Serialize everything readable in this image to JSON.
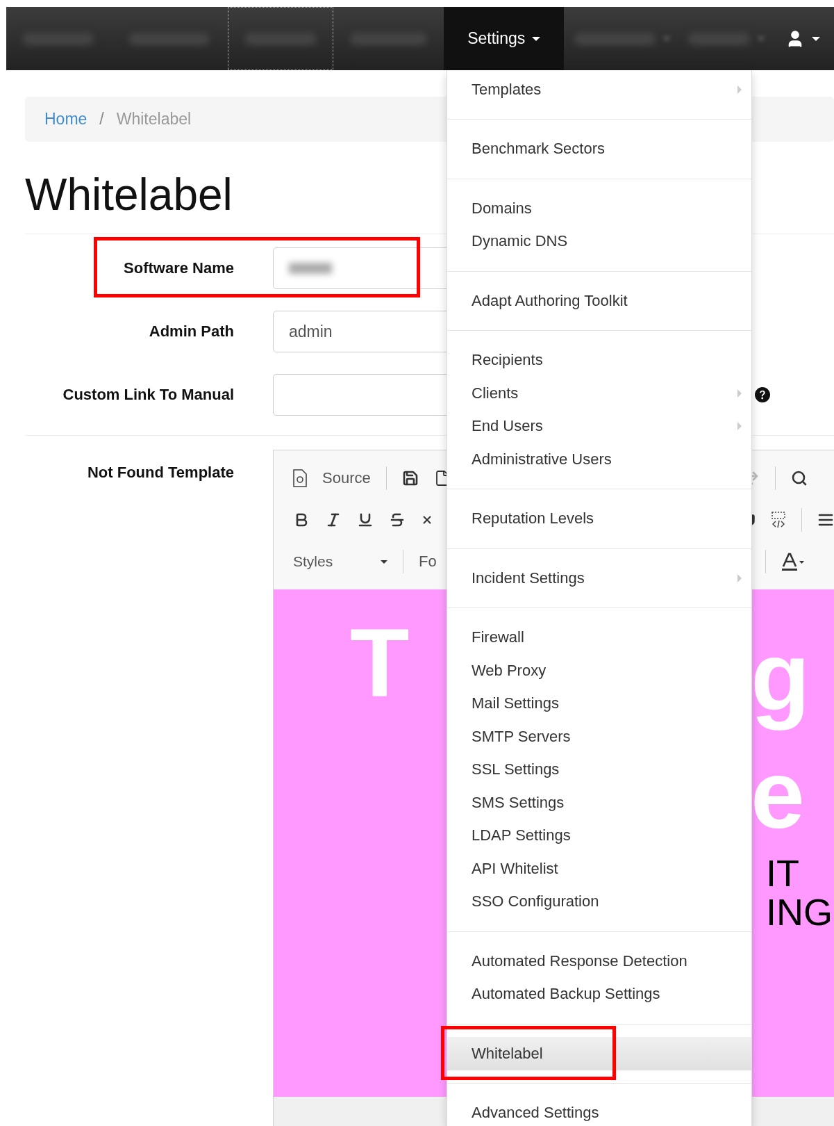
{
  "navbar": {
    "items": [
      {
        "kind": "redacted",
        "selected": false,
        "focused": false,
        "caret": false
      },
      {
        "kind": "redacted",
        "selected": false,
        "focused": false,
        "caret": false
      },
      {
        "kind": "redacted",
        "selected": false,
        "focused": true,
        "caret": false
      },
      {
        "kind": "redacted",
        "selected": false,
        "focused": false,
        "caret": false
      },
      {
        "kind": "menu",
        "label": "Settings",
        "selected": true,
        "focused": false,
        "caret": true
      },
      {
        "kind": "redacted",
        "selected": false,
        "focused": false,
        "caret": true
      },
      {
        "kind": "redacted",
        "selected": false,
        "focused": false,
        "caret": true
      },
      {
        "kind": "user",
        "selected": false,
        "focused": false,
        "caret": true
      }
    ]
  },
  "breadcrumb": {
    "items": [
      {
        "label": "Home",
        "kind": "link"
      },
      {
        "label": "Whitelabel",
        "kind": "current"
      }
    ],
    "separator": "/"
  },
  "page_title": "Whitelabel",
  "form": {
    "fields": [
      {
        "label": "Software Name",
        "kind": "redacted",
        "annotated": true,
        "help": false
      },
      {
        "label": "Admin Path",
        "kind": "text",
        "value": "admin",
        "annotated": false,
        "help": false
      },
      {
        "label": "Custom Link To Manual",
        "kind": "text",
        "annotated": false,
        "help": true
      }
    ]
  },
  "editor": {
    "label": "Not Found Template",
    "toolbar_texts": {
      "source": "Source",
      "styles": "Styles",
      "format": "Fo"
    },
    "content_left": [
      "T"
    ],
    "content_right": [
      {
        "text": "g",
        "kind": "big"
      },
      {
        "text": "e",
        "kind": "big"
      },
      {
        "text": "IT",
        "kind": "normal"
      },
      {
        "text": "ING",
        "kind": "normal"
      }
    ]
  },
  "settings_menu": {
    "groups": [
      {
        "items": [
          {
            "label": "Templates",
            "submenu": true,
            "selected": false,
            "annotated": false
          }
        ]
      },
      {
        "items": [
          {
            "label": "Benchmark Sectors",
            "submenu": false,
            "selected": false,
            "annotated": false
          }
        ]
      },
      {
        "items": [
          {
            "label": "Domains",
            "submenu": false,
            "selected": false,
            "annotated": false
          },
          {
            "label": "Dynamic DNS",
            "submenu": false,
            "selected": false,
            "annotated": false
          }
        ]
      },
      {
        "items": [
          {
            "label": "Adapt Authoring Toolkit",
            "submenu": false,
            "selected": false,
            "annotated": false
          }
        ]
      },
      {
        "items": [
          {
            "label": "Recipients",
            "submenu": false,
            "selected": false,
            "annotated": false
          },
          {
            "label": "Clients",
            "submenu": true,
            "selected": false,
            "annotated": false
          },
          {
            "label": "End Users",
            "submenu": true,
            "selected": false,
            "annotated": false
          },
          {
            "label": "Administrative Users",
            "submenu": false,
            "selected": false,
            "annotated": false
          }
        ]
      },
      {
        "items": [
          {
            "label": "Reputation Levels",
            "submenu": false,
            "selected": false,
            "annotated": false
          }
        ]
      },
      {
        "items": [
          {
            "label": "Incident Settings",
            "submenu": true,
            "selected": false,
            "annotated": false
          }
        ]
      },
      {
        "items": [
          {
            "label": "Firewall",
            "submenu": false,
            "selected": false,
            "annotated": false
          },
          {
            "label": "Web Proxy",
            "submenu": false,
            "selected": false,
            "annotated": false
          },
          {
            "label": "Mail Settings",
            "submenu": false,
            "selected": false,
            "annotated": false
          },
          {
            "label": "SMTP Servers",
            "submenu": false,
            "selected": false,
            "annotated": false
          },
          {
            "label": "SSL Settings",
            "submenu": false,
            "selected": false,
            "annotated": false
          },
          {
            "label": "SMS Settings",
            "submenu": false,
            "selected": false,
            "annotated": false
          },
          {
            "label": "LDAP Settings",
            "submenu": false,
            "selected": false,
            "annotated": false
          },
          {
            "label": "API Whitelist",
            "submenu": false,
            "selected": false,
            "annotated": false
          },
          {
            "label": "SSO Configuration",
            "submenu": false,
            "selected": false,
            "annotated": false
          }
        ]
      },
      {
        "items": [
          {
            "label": "Automated Response Detection",
            "submenu": false,
            "selected": false,
            "annotated": false
          },
          {
            "label": "Automated Backup Settings",
            "submenu": false,
            "selected": false,
            "annotated": false
          }
        ]
      },
      {
        "items": [
          {
            "label": "Whitelabel",
            "submenu": false,
            "selected": true,
            "annotated": true
          }
        ]
      },
      {
        "items": [
          {
            "label": "Advanced Settings",
            "submenu": false,
            "selected": false,
            "annotated": false
          }
        ]
      }
    ]
  }
}
